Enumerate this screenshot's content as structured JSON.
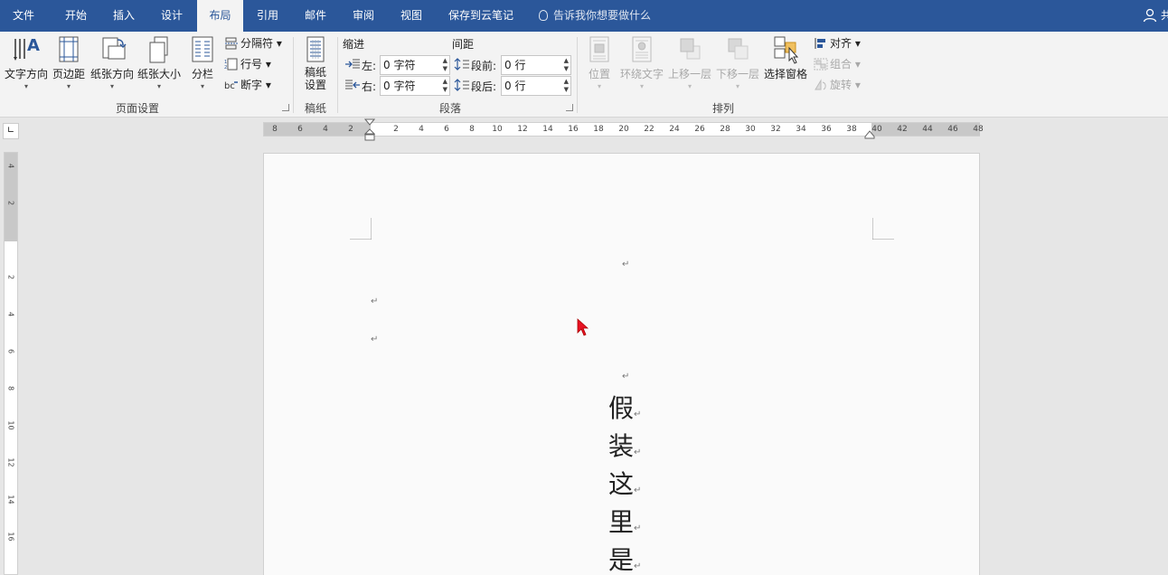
{
  "tabs": [
    "文件",
    "开始",
    "插入",
    "设计",
    "布局",
    "引用",
    "邮件",
    "审阅",
    "视图",
    "保存到云笔记"
  ],
  "active_tab": "布局",
  "tell_me": "告诉我你想要做什么",
  "user_text": "共",
  "ribbon": {
    "page_setup": {
      "group_label": "页面设置",
      "text_direction": "文字方向",
      "margins": "页边距",
      "orientation": "纸张方向",
      "size": "纸张大小",
      "columns": "分栏",
      "breaks": "分隔符",
      "line_numbers": "行号",
      "hyphenation": "断字"
    },
    "manuscript": {
      "group_label": "稿纸",
      "settings_line1": "稿纸",
      "settings_line2": "设置"
    },
    "paragraph": {
      "group_label": "段落",
      "indent_header": "缩进",
      "spacing_header": "间距",
      "left_label": "左:",
      "left_value": "0 字符",
      "right_label": "右:",
      "right_value": "0 字符",
      "before_label": "段前:",
      "before_value": "0 行",
      "after_label": "段后:",
      "after_value": "0 行"
    },
    "arrange": {
      "group_label": "排列",
      "position": "位置",
      "wrap_text": "环绕文字",
      "bring_forward": "上移一层",
      "send_backward": "下移一层",
      "selection_pane": "选择窗格",
      "align": "对齐",
      "group": "组合",
      "rotate": "旋转"
    }
  },
  "ruler": {
    "left_numbers": [
      "8",
      "6",
      "4",
      "2"
    ],
    "right_numbers": [
      "2",
      "4",
      "6",
      "8",
      "10",
      "12",
      "14",
      "16",
      "18",
      "20",
      "22",
      "24",
      "26",
      "28",
      "30",
      "32",
      "34",
      "36",
      "38",
      "40",
      "42",
      "44",
      "46",
      "48"
    ],
    "vertical_numbers": [
      "4",
      "2",
      "",
      "2",
      "4",
      "6",
      "8",
      "10",
      "12",
      "14",
      "16"
    ]
  },
  "document": {
    "paragraph_mark": "↵",
    "vertical_text": [
      "假",
      "装",
      "这",
      "里",
      "是"
    ]
  },
  "colors": {
    "title_bar": "#2b579a",
    "ribbon": "#f3f3f3",
    "cursor": "#e81123"
  }
}
